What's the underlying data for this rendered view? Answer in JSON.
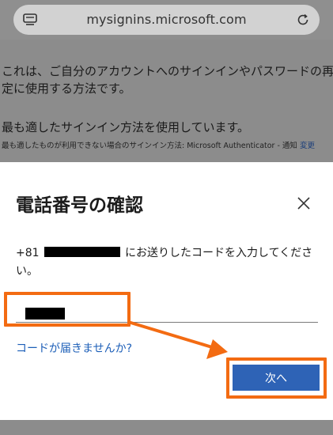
{
  "browser": {
    "url": "mysignins.microsoft.com"
  },
  "background_page": {
    "line1": "これは、ご自分のアカウントへのサインインやパスワードの再設",
    "line2": "定に使用する方法です。",
    "line3": "最も適したサインイン方法を使用しています。",
    "small_text": "最も適したものが利用できない場合のサインイン方法: Microsoft Authenticator - 通知",
    "change_link": "変更"
  },
  "dialog": {
    "title": "電話番号の確認",
    "desc_prefix": "+81",
    "desc_suffix": "にお送りしたコードを入力してください。",
    "no_code_link": "コードが届きませんか?",
    "next_button": "次へ"
  },
  "colors": {
    "highlight": "#f36b12",
    "primary": "#2e63b6",
    "link": "#1d5fb8"
  }
}
